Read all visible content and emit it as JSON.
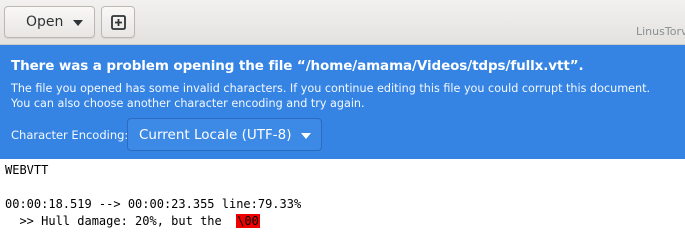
{
  "header": {
    "open_label": "Open",
    "window_title": "LinusTorvalds"
  },
  "infobar": {
    "title": "There was a problem opening the file “/home/amama/Videos/tdps/fullx.vtt”.",
    "message_line1": "The file you opened has some invalid characters. If you continue editing this file you could corrupt this document.",
    "message_line2": "You can also choose another character encoding and try again.",
    "encoding_label": "Character Encoding:",
    "encoding_value": "Current Locale (UTF-8)",
    "background_color": "#3584e4"
  },
  "editor": {
    "lines": [
      "WEBVTT",
      "",
      "00:00:18.519 --> 00:00:23.355 line:79.33%",
      "  >> Hull damage: 20%, but the  "
    ],
    "invalid_sequence": "\\00",
    "invalid_highlight_color": "#ef0000"
  }
}
